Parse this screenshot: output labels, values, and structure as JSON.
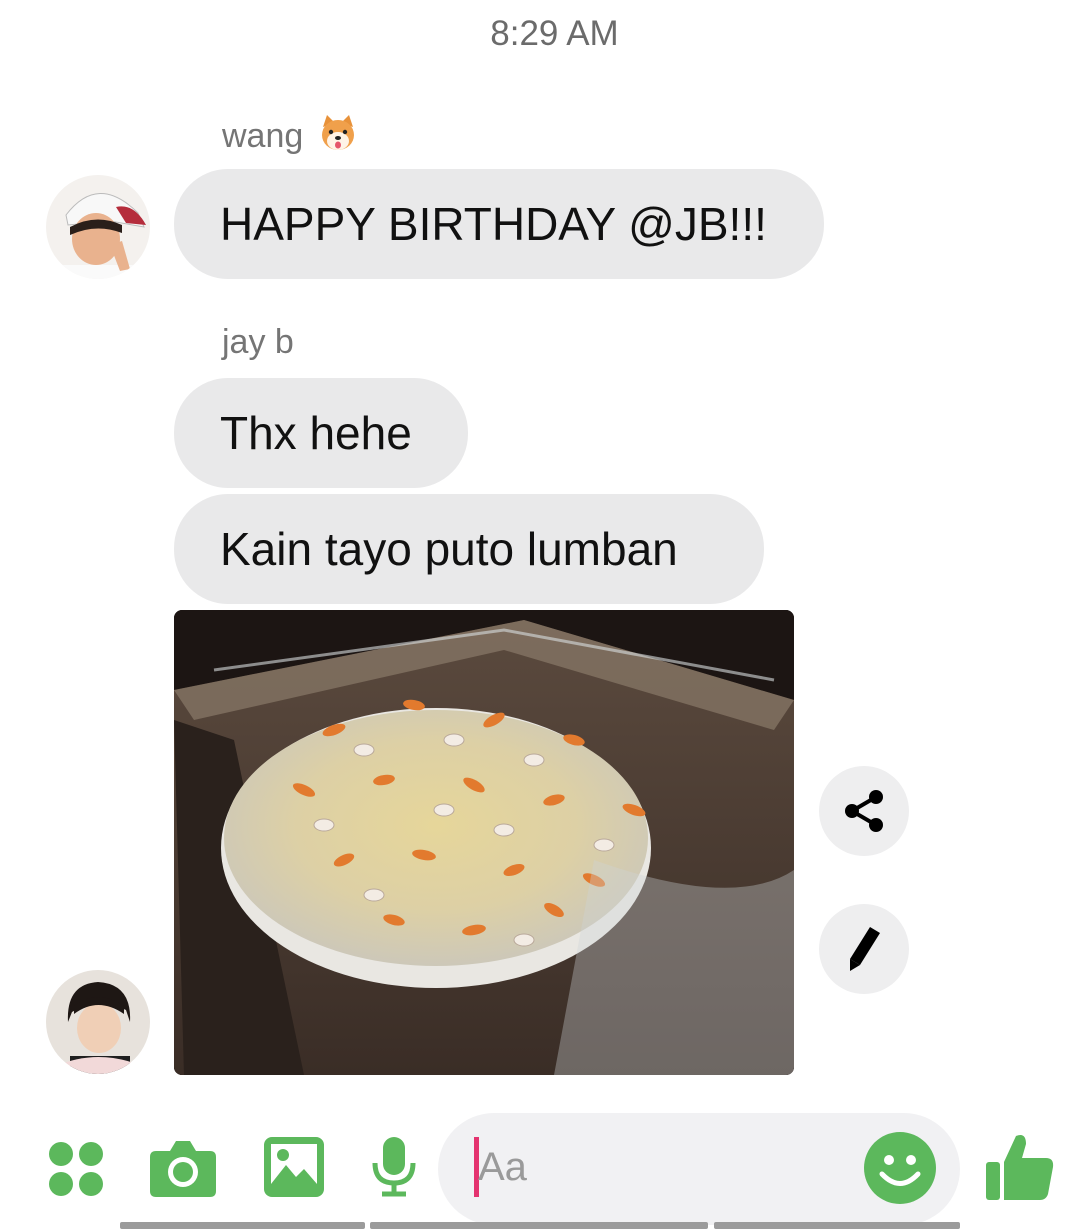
{
  "header": {
    "timestamp": "8:29 AM"
  },
  "messages": [
    {
      "sender": "wang",
      "sender_emoji": "shiba-dog-emoji",
      "text": "HAPPY BIRTHDAY @JB!!!"
    },
    {
      "sender": "jay b",
      "texts": [
        "Thx hehe",
        "Kain tayo puto lumban"
      ],
      "attachment": "photo-puto-lumban"
    }
  ],
  "actions": {
    "share_icon": "share-icon",
    "edit_icon": "pencil-icon"
  },
  "composer": {
    "placeholder": "Aa",
    "tools": [
      "apps-icon",
      "camera-icon",
      "gallery-icon",
      "microphone-icon"
    ],
    "emoji_icon": "smiley-icon",
    "send_icon": "thumbs-up-icon",
    "accent_color": "#5cb85c",
    "caret_color": "#e4336f"
  }
}
